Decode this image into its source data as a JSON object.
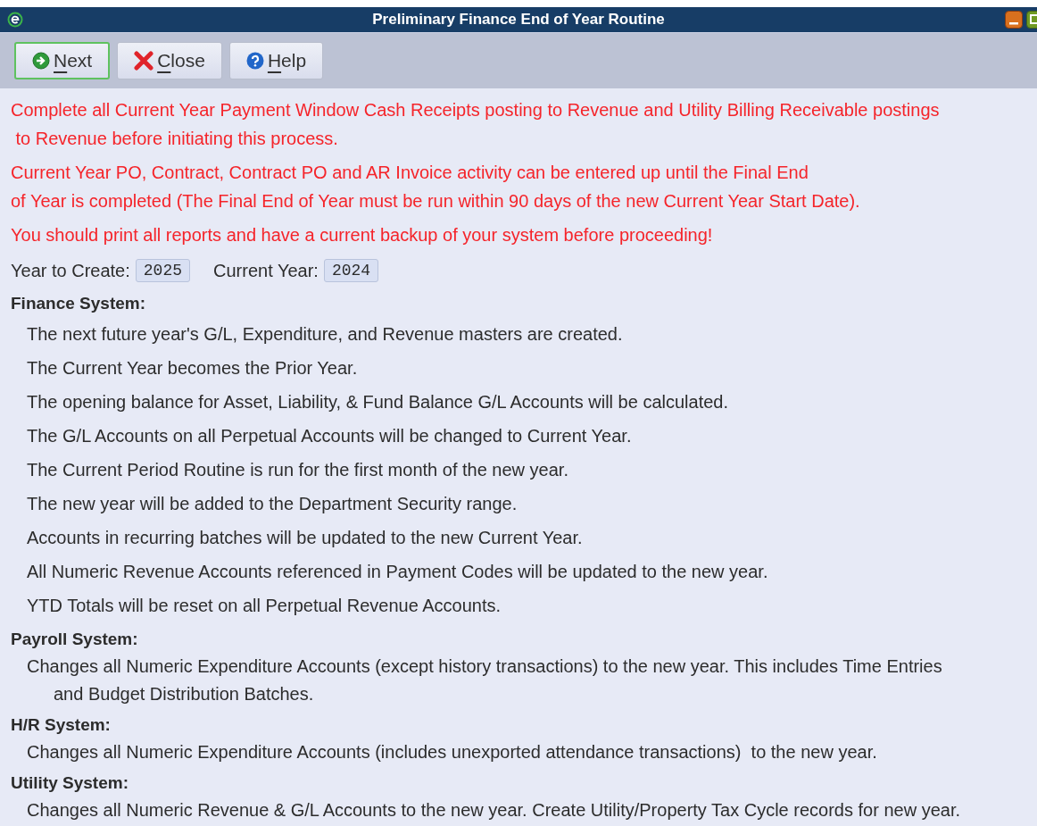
{
  "window": {
    "title": "Preliminary Finance End of Year Routine"
  },
  "toolbar": [
    {
      "kind": "next",
      "label": "Next",
      "focused": true
    },
    {
      "kind": "close",
      "label": "Close",
      "focused": false
    },
    {
      "kind": "help",
      "label": "Help",
      "focused": false
    }
  ],
  "warnings": [
    {
      "lines": [
        "Complete all Current Year Payment Window Cash Receipts posting to Revenue and Utility Billing Receivable postings",
        " to Revenue before initiating this process."
      ]
    },
    {
      "lines": [
        "Current Year PO, Contract, Contract PO and AR Invoice activity can be entered up until the Final End",
        "of Year is completed (The Final End of Year must be run within 90 days of the new Current Year Start Date)."
      ]
    },
    {
      "lines": [
        "You should print all reports and have a current backup of your system before proceeding!"
      ]
    }
  ],
  "years": [
    {
      "label": "Year to Create:",
      "value": "2025"
    },
    {
      "label": "Current Year:",
      "value": "2024"
    }
  ],
  "sections": [
    {
      "heading": "Finance System:",
      "kind": "spaced",
      "items": [
        {
          "lines": [
            "The next future year's G/L, Expenditure, and Revenue masters are created."
          ]
        },
        {
          "lines": [
            "The Current Year becomes the Prior Year."
          ]
        },
        {
          "lines": [
            "The opening balance for Asset, Liability, & Fund Balance G/L Accounts will be calculated."
          ]
        },
        {
          "lines": [
            "The G/L Accounts on all Perpetual Accounts will be changed to Current Year."
          ]
        },
        {
          "lines": [
            "The Current Period Routine is run for the first month of the new year."
          ]
        },
        {
          "lines": [
            "The new year will be added to the Department Security range."
          ]
        },
        {
          "lines": [
            "Accounts in recurring batches will be updated to the new Current Year."
          ]
        },
        {
          "lines": [
            "All Numeric Revenue Accounts referenced in Payment Codes will be updated to the new year."
          ]
        },
        {
          "lines": [
            "YTD Totals will be reset on all Perpetual Revenue Accounts."
          ]
        }
      ]
    },
    {
      "heading": "Payroll System:",
      "kind": "compact",
      "items": [
        {
          "lines": [
            "Changes all Numeric Expenditure Accounts (except history transactions) to the new year. This includes Time Entries",
            "and Budget Distribution Batches."
          ]
        }
      ]
    },
    {
      "heading": "H/R System:",
      "kind": "compact",
      "items": [
        {
          "lines": [
            "Changes all Numeric Expenditure Accounts (includes unexported attendance transactions)  to the new year."
          ]
        }
      ]
    },
    {
      "heading": "Utility System:",
      "kind": "compact",
      "items": [
        {
          "lines": [
            "Changes all Numeric Revenue & G/L Accounts to the new year. Create Utility/Property Tax Cycle records for new year."
          ]
        }
      ]
    }
  ]
}
